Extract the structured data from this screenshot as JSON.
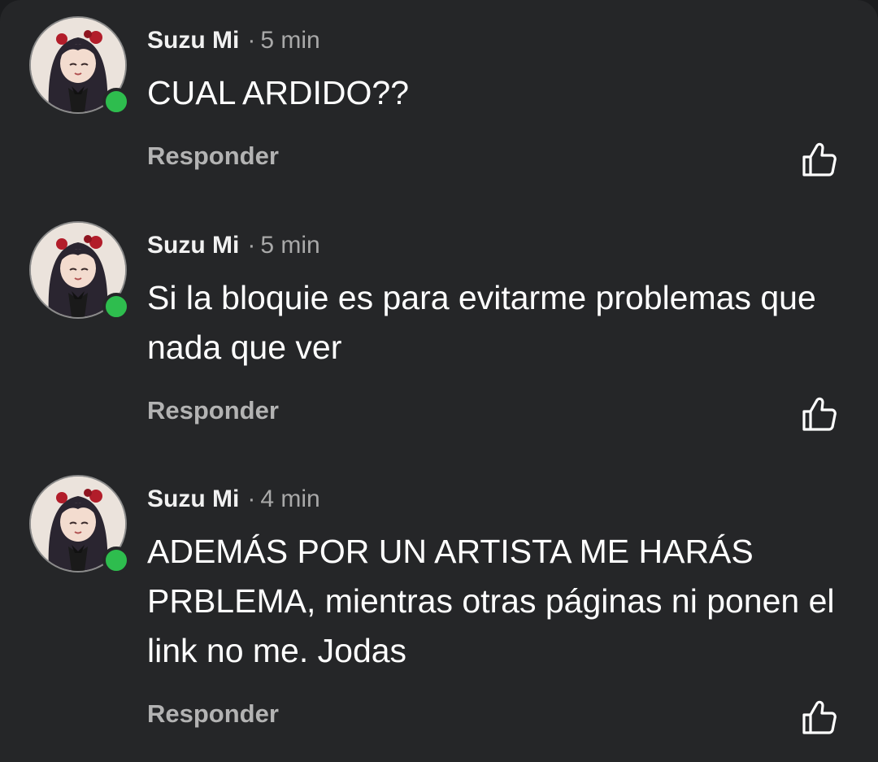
{
  "comments": [
    {
      "author": "Suzu Mi",
      "separator": "·",
      "time": "5 min",
      "text": "CUAL ARDIDO??",
      "reply_label": "Responder",
      "avatar_icon": "anime-girl-avatar",
      "status": "online",
      "like_icon": "thumbs-up-icon"
    },
    {
      "author": "Suzu Mi",
      "separator": "·",
      "time": "5 min",
      "text": "Si la bloquie es para evitarme problemas que nada que ver",
      "reply_label": "Responder",
      "avatar_icon": "anime-girl-avatar",
      "status": "online",
      "like_icon": "thumbs-up-icon"
    },
    {
      "author": "Suzu Mi",
      "separator": "·",
      "time": "4 min",
      "text": "ADEMÁS POR UN ARTISTA ME HARÁS PRBLEMA, mientras otras páginas ni ponen el link no me. Jodas",
      "reply_label": "Responder",
      "avatar_icon": "anime-girl-avatar",
      "status": "online",
      "like_icon": "thumbs-up-icon"
    }
  ],
  "colors": {
    "background": "#252628",
    "online": "#2ebd4e",
    "text": "#ffffff",
    "muted": "#a9a9a9"
  }
}
